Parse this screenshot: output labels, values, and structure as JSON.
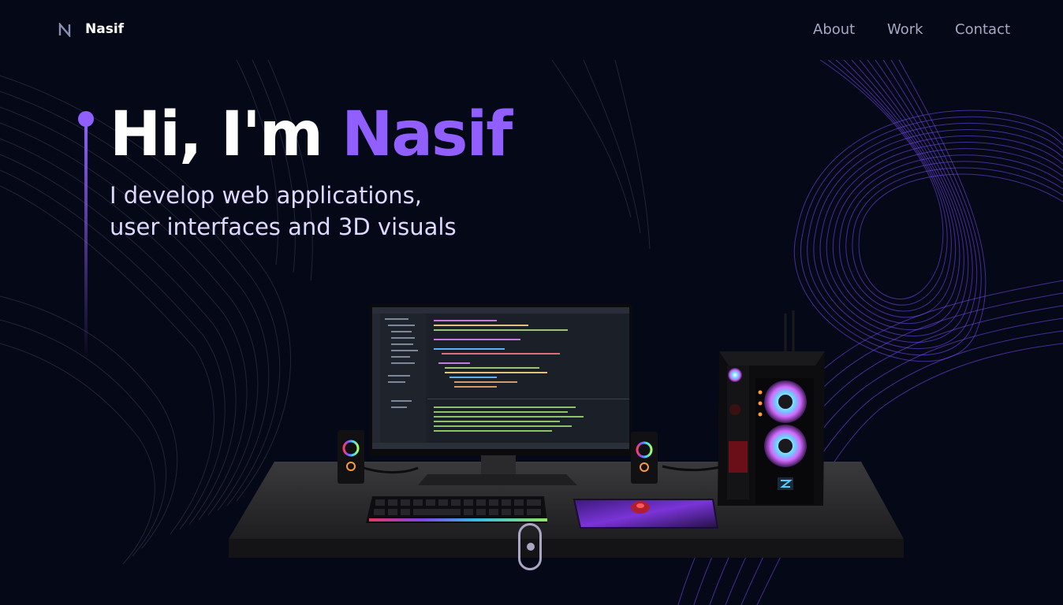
{
  "nav": {
    "brand": "Nasif",
    "links": [
      "About",
      "Work",
      "Contact"
    ]
  },
  "hero": {
    "greeting": "Hi, I'm ",
    "name": "Nasif",
    "subtitle_line1": "I develop web applications,",
    "subtitle_line2": "user interfaces and 3D visuals"
  },
  "colors": {
    "background": "#050816",
    "accent": "#915eff",
    "nav_text": "#aaa6c3",
    "subtitle": "#dfd9ff"
  },
  "icons": {
    "logo": "n-logo-icon",
    "scroll": "mouse-scroll-icon"
  }
}
